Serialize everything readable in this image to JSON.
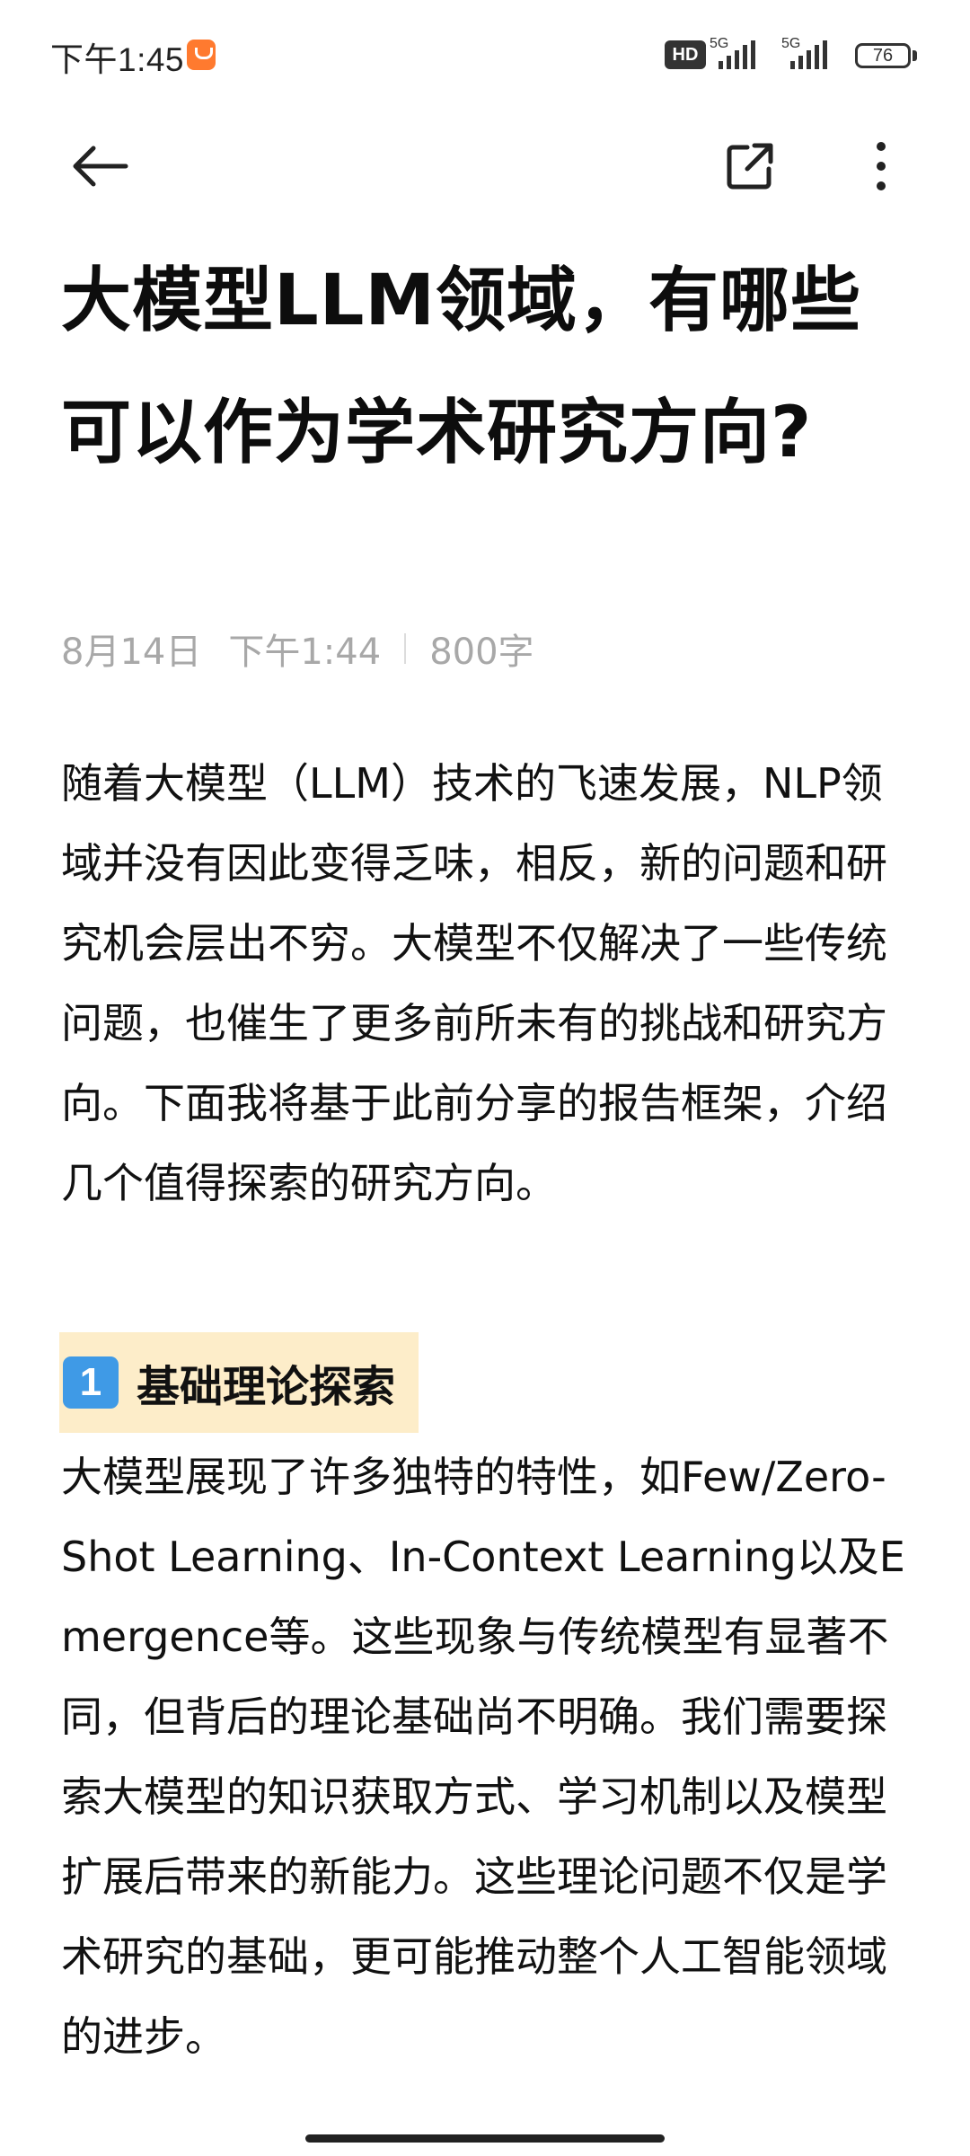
{
  "status_bar": {
    "time": "下午1:45",
    "hd_label": "HD",
    "network_1": "5G",
    "network_2": "5G",
    "battery": "76"
  },
  "toolbar": {
    "back_icon": "arrow-left-icon",
    "share_icon": "share-external-icon",
    "more_icon": "more-vertical-icon"
  },
  "article": {
    "title": "大模型LLM领域，有哪些可以作为学术研究方向?",
    "meta": {
      "date": "8月14日",
      "time": "下午1:44",
      "word_count": "800字"
    },
    "paragraph_1": "随着大模型（LLM）技术的飞速发展，NLP领域并没有因此变得乏味，相反，新的问题和研究机会层出不穷。大模型不仅解决了一些传统问题，也催生了更多前所未有的挑战和研究方向。下面我将基于此前分享的报告框架，介绍几个值得探索的研究方向。",
    "section_1": {
      "number": "1",
      "heading": "基础理论探索"
    },
    "paragraph_2": "大模型展现了许多独特的特性，如Few/Zero-Shot Learning、In-Context Learning以及Emergence等。这些现象与传统模型有显著不同，但背后的理论基础尚不明确。我们需要探索大模型的知识获取方式、学习机制以及模型扩展后带来的新能力。这些理论问题不仅是学术研究的基础，更可能推动整个人工智能领域的进步。"
  },
  "colors": {
    "highlight": "#fdedc9",
    "badge": "#3f9ae6",
    "notification": "#ff7a2f",
    "meta_text": "#a8a8a8"
  }
}
